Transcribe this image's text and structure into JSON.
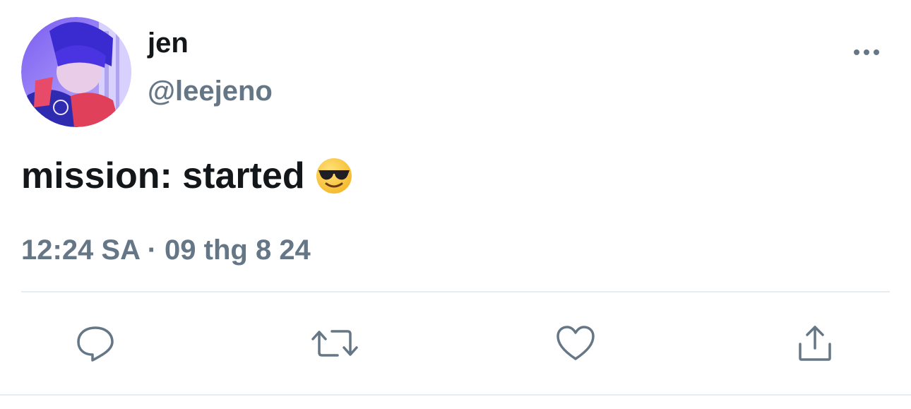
{
  "author": {
    "display_name": "jen",
    "handle": "@leejeno",
    "avatar": "profile-photo"
  },
  "tweet": {
    "text": "mission: started",
    "emoji": "smiling-face-with-sunglasses"
  },
  "meta": {
    "timestamp": "12:24 SA · 09 thg 8 24"
  },
  "icons": {
    "more": "more-horizontal-icon",
    "reply": "reply-icon",
    "retweet": "retweet-icon",
    "like": "heart-icon",
    "share": "share-icon"
  },
  "colors": {
    "text_primary": "#14171a",
    "text_secondary": "#657786",
    "divider": "#e6ecf0"
  }
}
